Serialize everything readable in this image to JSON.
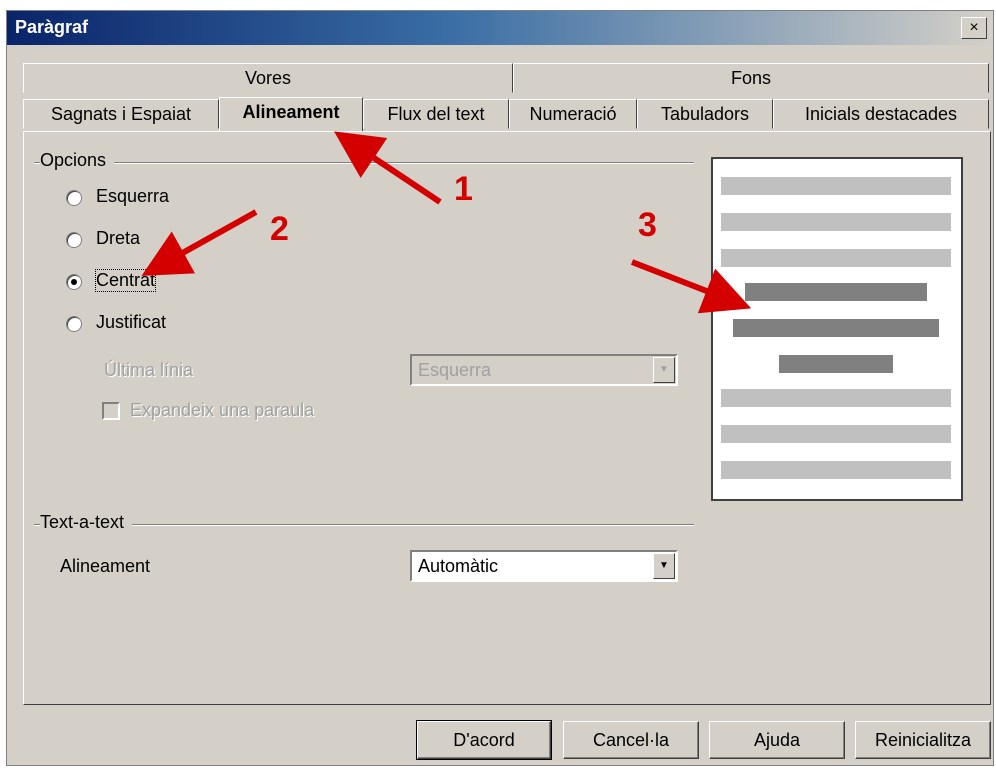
{
  "window": {
    "title": "Paràgraf",
    "close_glyph": "×"
  },
  "tabs_row1": [
    {
      "label": "Vores"
    },
    {
      "label": "Fons"
    }
  ],
  "tabs_row2": [
    {
      "label": "Sagnats i Espaiat"
    },
    {
      "label": "Alineament"
    },
    {
      "label": "Flux del text"
    },
    {
      "label": "Numeració"
    },
    {
      "label": "Tabuladors"
    },
    {
      "label": "Inicials destacades"
    }
  ],
  "active_tab": "Alineament",
  "options": {
    "group_title": "Opcions",
    "radios": [
      {
        "label": "Esquerra",
        "checked": false
      },
      {
        "label": "Dreta",
        "checked": false
      },
      {
        "label": "Centrat",
        "checked": true
      },
      {
        "label": "Justificat",
        "checked": false
      }
    ],
    "last_line_label": "Última línia",
    "last_line_value": "Esquerra",
    "expand_word_label": "Expandeix una paraula"
  },
  "text_to_text": {
    "group_title": "Text-a-text",
    "alignment_label": "Alineament",
    "alignment_value": "Automàtic"
  },
  "buttons": {
    "ok": "D'acord",
    "cancel": "Cancel·la",
    "help": "Ajuda",
    "reset": "Reinicialitza"
  },
  "annotations": [
    "1",
    "2",
    "3"
  ],
  "colors": {
    "annotation_red": "#d40000",
    "preview_light": "#c0c0c0",
    "preview_dark": "#808080"
  },
  "icons": {
    "dropdown": "chevron-down-icon",
    "close": "close-icon"
  }
}
